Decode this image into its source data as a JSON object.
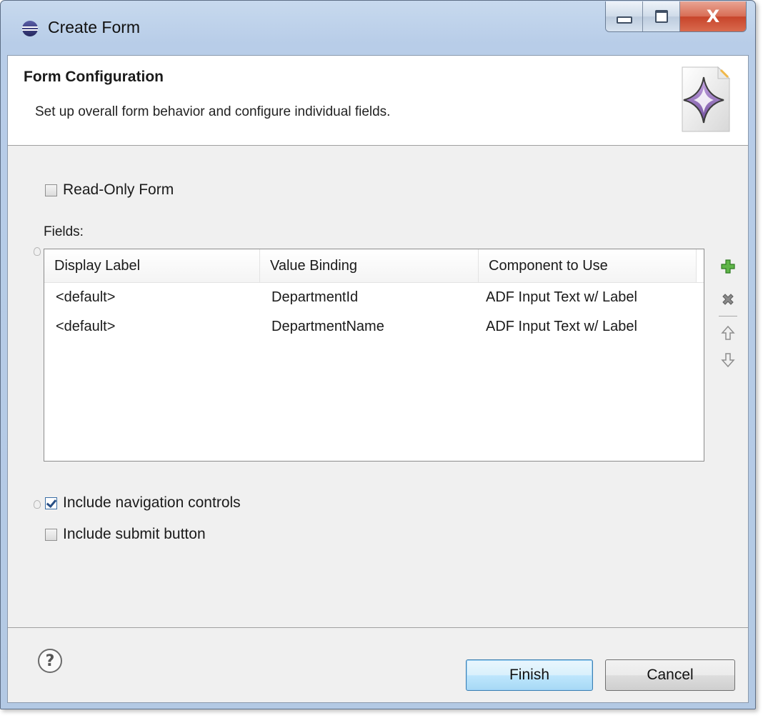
{
  "window": {
    "title": "Create Form",
    "close_glyph": "X"
  },
  "banner": {
    "title": "Form Configuration",
    "description": "Set up overall form behavior and configure individual fields."
  },
  "options": {
    "read_only": {
      "label": "Read-Only Form",
      "checked": false
    },
    "navigation": {
      "label": "Include navigation controls",
      "checked": true
    },
    "submit": {
      "label": "Include submit button",
      "checked": false
    }
  },
  "fields": {
    "label": "Fields:",
    "columns": [
      "Display Label",
      "Value Binding",
      "Component to Use"
    ],
    "rows": [
      [
        "<default>",
        "DepartmentId",
        "ADF Input Text w/ Label"
      ],
      [
        "<default>",
        "DepartmentName",
        "ADF Input Text w/ Label"
      ]
    ]
  },
  "toolbar_icons": [
    "add-icon",
    "delete-icon",
    "move-up-icon",
    "move-down-icon"
  ],
  "footer": {
    "help_glyph": "?",
    "finish_label": "Finish",
    "cancel_label": "Cancel"
  },
  "colors": {
    "add_green": "#4aa33a",
    "delete_gray": "#7d7d7d",
    "accent_blue": "#3c7fb1"
  }
}
